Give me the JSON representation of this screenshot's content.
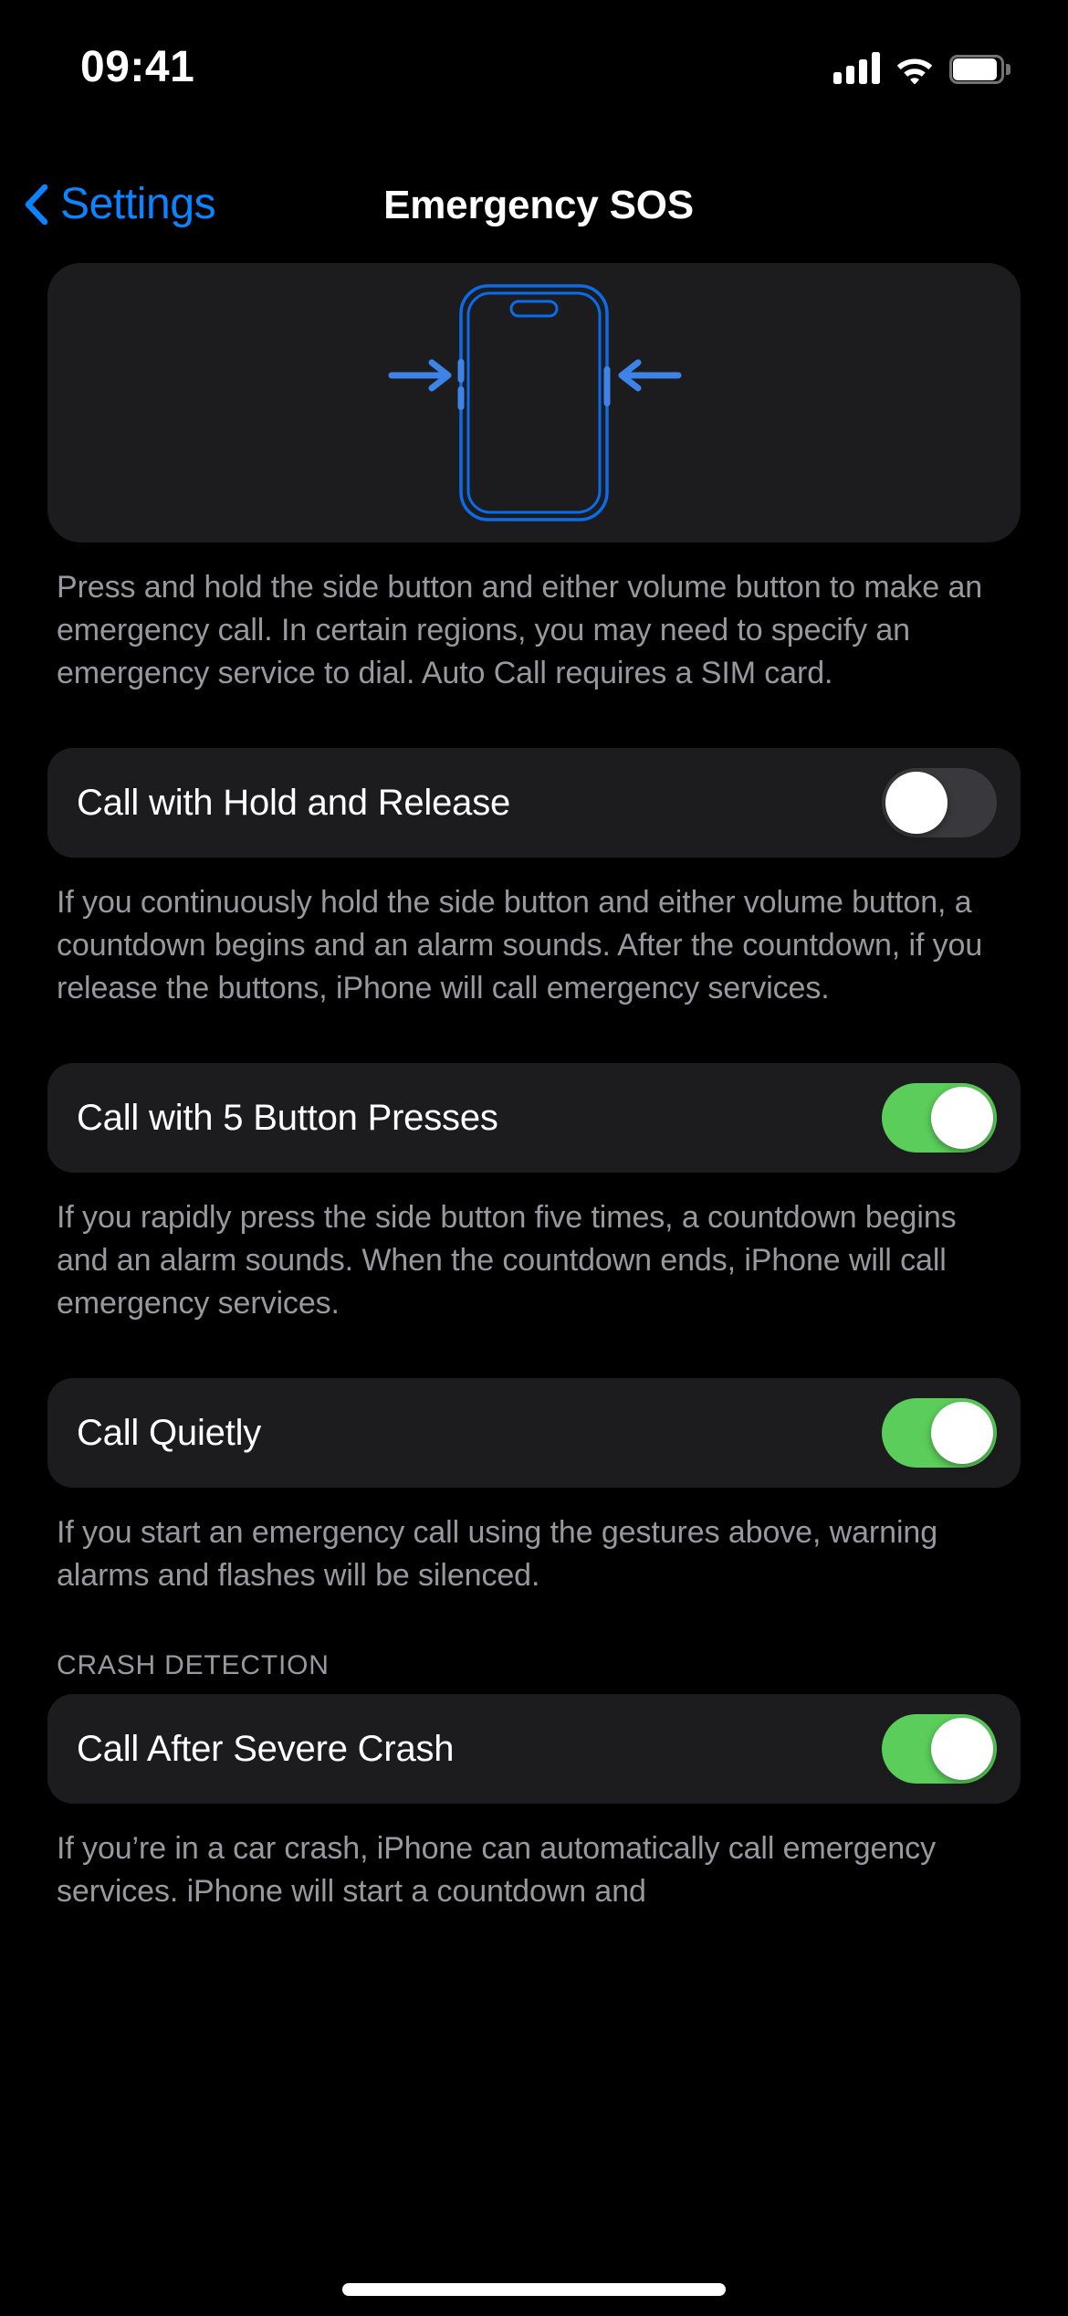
{
  "status_bar": {
    "time": "09:41",
    "cellular_icon": "cellular-bars-icon",
    "wifi_icon": "wifi-icon",
    "battery_icon": "battery-full-icon"
  },
  "nav": {
    "back_icon": "chevron-left-icon",
    "back_label": "Settings",
    "title": "Emergency SOS"
  },
  "hero": {
    "illustration": "iphone-side-buttons-illustration",
    "accent_color": "#0A84FF"
  },
  "sections": [
    {
      "footer": "Press and hold the side button and either volume button to make an emergency call. In certain regions, you may need to specify an emergency service to dial. Auto Call requires a SIM card."
    },
    {
      "rows": [
        {
          "label": "Call with Hold and Release",
          "toggle": "off"
        }
      ],
      "footer": "If you continuously hold the side button and either volume button, a countdown begins and an alarm sounds. After the countdown, if you release the buttons, iPhone will call emergency services."
    },
    {
      "rows": [
        {
          "label": "Call with 5 Button Presses",
          "toggle": "on"
        }
      ],
      "footer": "If you rapidly press the side button five times, a countdown begins and an alarm sounds. When the countdown ends, iPhone will call emergency services."
    },
    {
      "rows": [
        {
          "label": "Call Quietly",
          "toggle": "on"
        }
      ],
      "footer": "If you start an emergency call using the gestures above, warning alarms and flashes will be silenced."
    },
    {
      "header": "CRASH DETECTION",
      "rows": [
        {
          "label": "Call After Severe Crash",
          "toggle": "on"
        }
      ],
      "footer": "If you’re in a car crash, iPhone can automatically call emergency services. iPhone will start a countdown and"
    }
  ],
  "colors": {
    "background": "#000000",
    "card": "#1C1C1E",
    "accent_blue": "#0A84FF",
    "toggle_on": "#5ACD5A",
    "toggle_off": "#39393D",
    "secondary_text": "#98989E"
  },
  "home_indicator": "home-indicator"
}
